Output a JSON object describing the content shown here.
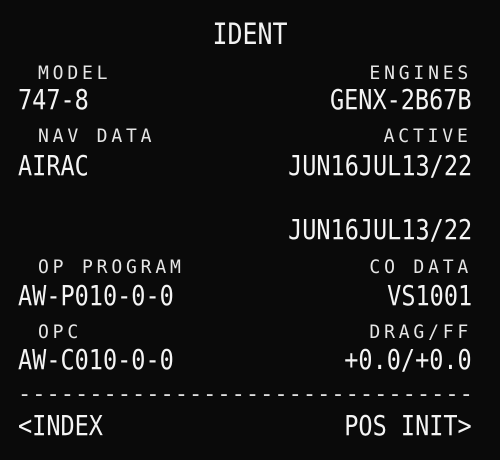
{
  "page_title": "IDENT",
  "model": {
    "label": "MODEL",
    "value": "747-8"
  },
  "engines": {
    "label": "ENGINES",
    "value": "GENX-2B67B"
  },
  "nav_data": {
    "label": "NAV DATA",
    "value": "AIRAC"
  },
  "active": {
    "label": "ACTIVE",
    "value": "JUN16JUL13/22"
  },
  "inactive": {
    "value": "JUN16JUL13/22"
  },
  "op_program": {
    "label": "OP PROGRAM",
    "value": "AW-P010-0-0"
  },
  "co_data": {
    "label": "CO DATA",
    "value": "VS1001"
  },
  "opc": {
    "label": "OPC",
    "value": "AW-C010-0-0"
  },
  "drag_ff": {
    "label": "DRAG/FF",
    "value": "+0.0/+0.0"
  },
  "divider": "------------------------------------",
  "nav": {
    "index": "<INDEX",
    "pos_init": "POS INIT>"
  },
  "colors": {
    "background": "#0a0a0a",
    "text": "#f2f2f2"
  }
}
